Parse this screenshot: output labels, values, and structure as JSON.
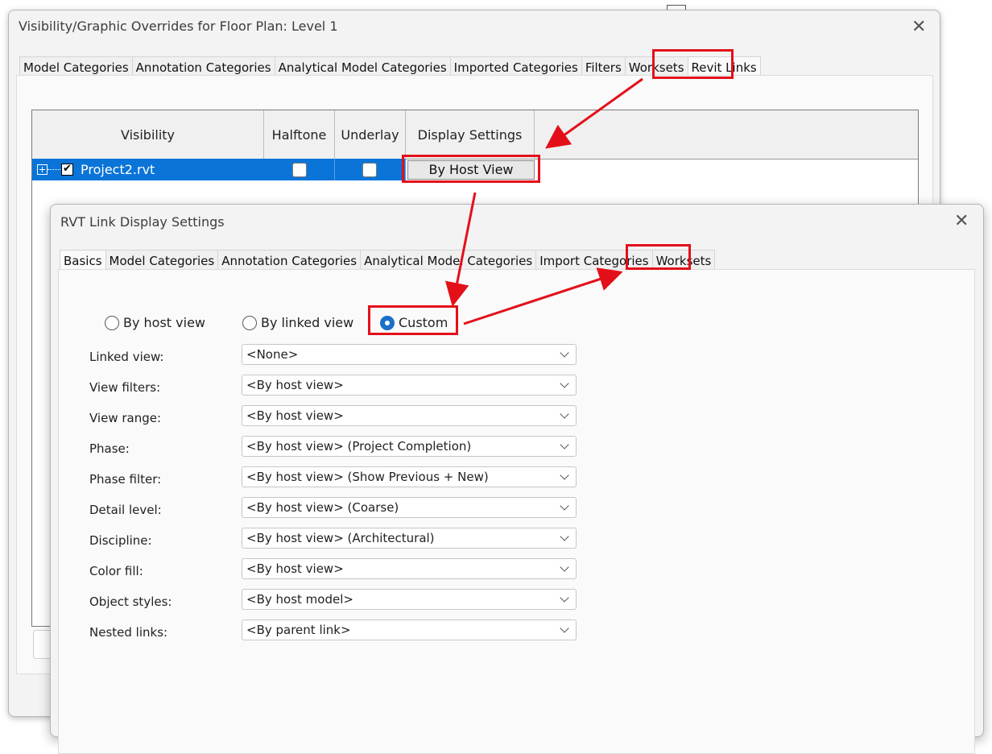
{
  "main_dialog": {
    "title": "Visibility/Graphic Overrides for Floor Plan: Level 1",
    "close_glyph": "✕",
    "tabs": [
      "Model Categories",
      "Annotation Categories",
      "Analytical Model Categories",
      "Imported Categories",
      "Filters",
      "Worksets",
      "Revit Links"
    ],
    "active_tab": "Revit Links",
    "table": {
      "headers": [
        "Visibility",
        "Halftone",
        "Underlay",
        "Display Settings"
      ],
      "rows": [
        {
          "name": "Project2.rvt",
          "visible_checked": "✔",
          "halftone": false,
          "underlay": false,
          "display_settings": "By Host View"
        }
      ]
    }
  },
  "link_dialog": {
    "title": "RVT Link Display Settings",
    "close_glyph": "✕",
    "tabs": [
      "Basics",
      "Model Categories",
      "Annotation Categories",
      "Analytical Model Categories",
      "Import Categories",
      "Worksets"
    ],
    "active_tab": "Basics",
    "radios": [
      "By host view",
      "By linked view",
      "Custom"
    ],
    "selected_radio": "Custom",
    "fields": [
      {
        "label": "Linked view:",
        "value": "<None>"
      },
      {
        "label": "View filters:",
        "value": "<By host view>"
      },
      {
        "label": "View range:",
        "value": "<By host view>"
      },
      {
        "label": "Phase:",
        "value": "<By host view> (Project Completion)"
      },
      {
        "label": "Phase filter:",
        "value": "<By host view> (Show Previous + New)"
      },
      {
        "label": "Detail level:",
        "value": "<By host view> (Coarse)"
      },
      {
        "label": "Discipline:",
        "value": "<By host view> (Architectural)"
      },
      {
        "label": "Color fill:",
        "value": "<By host view>"
      },
      {
        "label": "Object styles:",
        "value": "<By host model>"
      },
      {
        "label": "Nested links:",
        "value": "<By parent link>"
      }
    ]
  },
  "colors": {
    "highlight": "#e3101a",
    "selection": "#0a74d9",
    "radio_selected": "#1a6fc9"
  }
}
